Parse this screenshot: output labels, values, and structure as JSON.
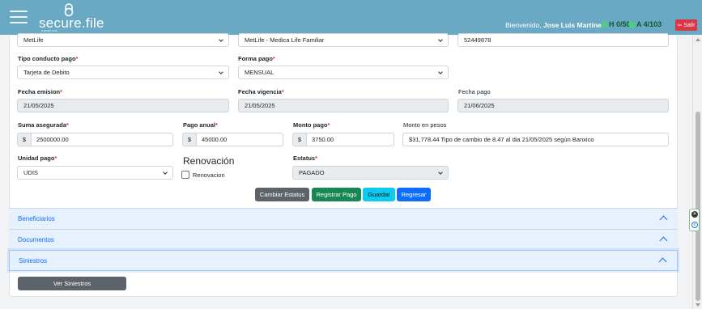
{
  "header": {
    "logo_text": "secure.file",
    "logo_sub": "a grupo aura",
    "welcome_prefix": "Bienvenido,",
    "user_name": "Jose Luis Martinez",
    "counter_h": "H 0/50",
    "counter_a": "A 4/103",
    "logout_label": "Salir"
  },
  "form": {
    "aseguradora": "MetLife",
    "producto": "MetLife - Medica Life Familiar",
    "poliza": "52449878",
    "tipo_conducto_label": "Tipo conducto pago",
    "tipo_conducto": "Tarjeta de Debito",
    "forma_pago_label": "Forma pago",
    "forma_pago": "MENSUAL",
    "fecha_emision_label": "Fecha emision",
    "fecha_emision": "21/05/2025",
    "fecha_vigencia_label": "Fecha vigencia",
    "fecha_vigencia": "21/05/2025",
    "fecha_pago_label": "Fecha pago",
    "fecha_pago": "21/06/2025",
    "suma_label": "Suma asegurada",
    "suma": "2500000.00",
    "pago_anual_label": "Pago anual",
    "pago_anual": "45000.00",
    "monto_pago_label": "Monto pago",
    "monto_pago": "3750.00",
    "monto_pesos_label": "Monto en pesos",
    "monto_pesos": "$31,778.44 Tipo de cambio de 8.47 al dia 21/05/2025 según Banxico",
    "currency_symbol": "$",
    "unidad_label": "Unidad pago",
    "unidad": "UDIS",
    "renovacion_title": "Renovación",
    "renovacion_check_label": "Renovacion",
    "renovacion_checked": false,
    "estatus_label": "Estatus",
    "estatus": "PAGADO",
    "required_mark": "*"
  },
  "buttons": {
    "cambiar_estatus": "Cambiar Estatus",
    "registrar_pago": "Registrar Pago",
    "guardar": "Guardar",
    "regresar": "Regresar"
  },
  "accordion": {
    "beneficiarios": "Beneficiarios",
    "documentos": "Documentos",
    "siniestros": "Siniestros",
    "ver_siniestros": "Ver Siniestros"
  },
  "colors": {
    "header_bg": "#6aa9c4",
    "btn_secondary": "#5c636a",
    "btn_success": "#198754",
    "btn_info": "#0dcaf0",
    "btn_primary": "#0d6efd",
    "danger": "#dc3545"
  }
}
